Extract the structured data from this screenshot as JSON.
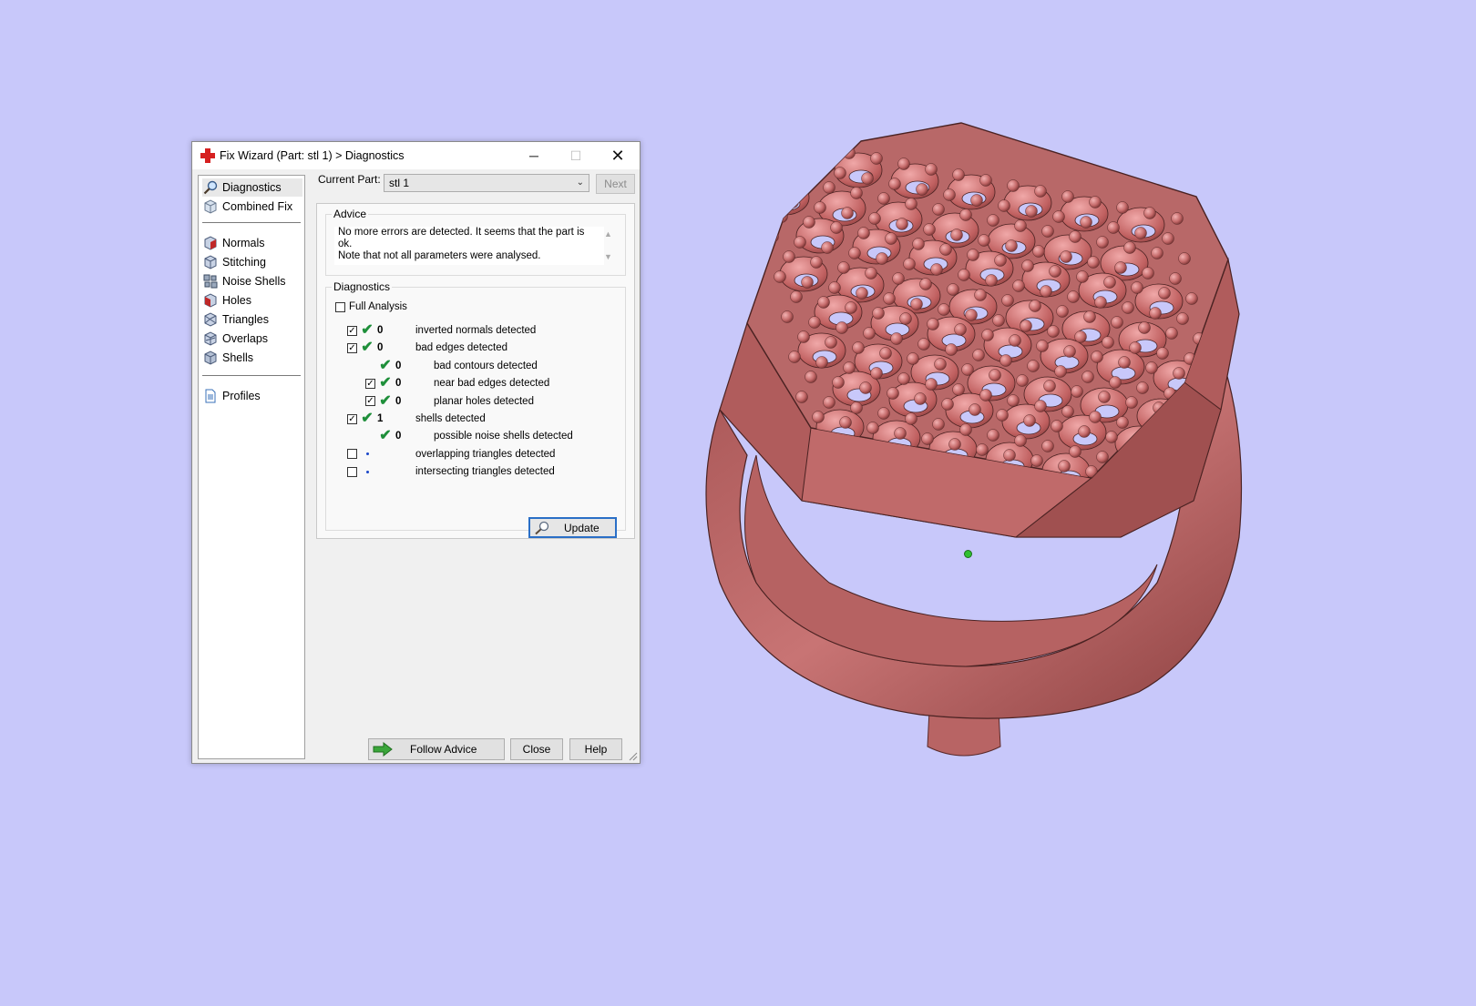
{
  "window": {
    "title": "Fix Wizard (Part: stl 1) > Diagnostics",
    "minimize_glyph": "─",
    "maximize_glyph": "☐",
    "close_glyph": "✕"
  },
  "sidebar": {
    "top_items": [
      {
        "label": "Diagnostics",
        "icon": "magnifier-icon",
        "selected": true
      },
      {
        "label": "Combined Fix",
        "icon": "cube-icon"
      }
    ],
    "tool_items": [
      {
        "label": "Normals",
        "icon": "normals-cube-icon"
      },
      {
        "label": "Stitching",
        "icon": "stitching-cube-icon"
      },
      {
        "label": "Noise Shells",
        "icon": "noise-shells-icon"
      },
      {
        "label": "Holes",
        "icon": "holes-cube-icon"
      },
      {
        "label": "Triangles",
        "icon": "triangles-cube-icon"
      },
      {
        "label": "Overlaps",
        "icon": "overlaps-cube-icon"
      },
      {
        "label": "Shells",
        "icon": "shells-cube-icon"
      }
    ],
    "bottom_items": [
      {
        "label": "Profiles",
        "icon": "document-icon"
      }
    ]
  },
  "current_part": {
    "label": "Current Part:",
    "value": "stl 1",
    "next_label": "Next"
  },
  "advice": {
    "title": "Advice",
    "line1": "No more errors are detected. It seems that the part is ok.",
    "line2": "Note that not all parameters were analysed."
  },
  "diagnostics": {
    "title": "Diagnostics",
    "full_analysis_label": "Full Analysis",
    "rows": [
      {
        "checked": true,
        "status": "ok",
        "count": "0",
        "label": "inverted normals detected"
      },
      {
        "checked": true,
        "status": "ok",
        "count": "0",
        "label": "bad edges detected"
      },
      {
        "checked": null,
        "status": "ok",
        "count": "0",
        "label": "bad contours detected"
      },
      {
        "checked": true,
        "status": "ok",
        "count": "0",
        "label": "near bad edges detected"
      },
      {
        "checked": true,
        "status": "ok",
        "count": "0",
        "label": "planar holes detected"
      },
      {
        "checked": true,
        "status": "ok",
        "count": "1",
        "label": "shells detected"
      },
      {
        "checked": null,
        "status": "ok",
        "count": "0",
        "label": "possible noise shells detected"
      },
      {
        "checked": false,
        "status": "not-analysed",
        "count": "",
        "label": "overlapping triangles detected"
      },
      {
        "checked": false,
        "status": "not-analysed",
        "count": "",
        "label": "intersecting triangles detected"
      }
    ],
    "update_label": "Update"
  },
  "footer": {
    "follow_advice_label": "Follow Advice",
    "close_label": "Close",
    "help_label": "Help"
  },
  "colors": {
    "viewport_background": "#c8c8fa",
    "model": "#c46e6e",
    "ok_check": "#1e8f3a",
    "accent": "#2a6fc7"
  }
}
